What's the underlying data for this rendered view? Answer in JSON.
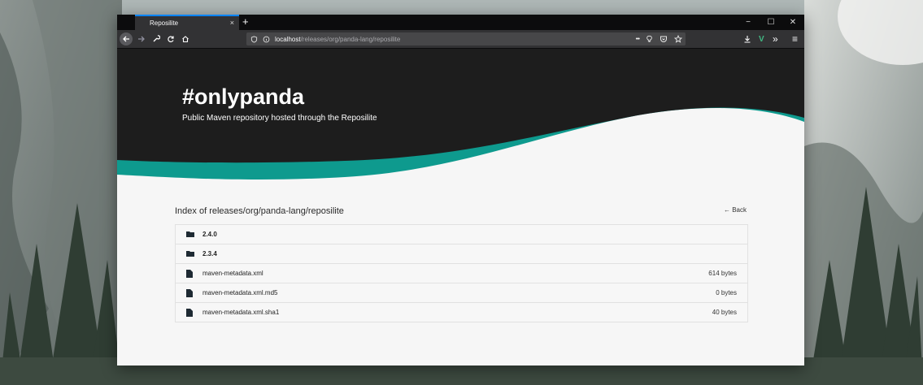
{
  "browser": {
    "tab_title": "Reposilite",
    "tab_close": "×",
    "new_tab": "+",
    "window_controls": {
      "minimize": "−",
      "maximize": "☐",
      "close": "✕"
    },
    "url_host": "localhost",
    "url_path": "/releases/org/panda-lang/reposilite",
    "url_icons": [
      "more-icon",
      "lightbulb-icon",
      "pocket-icon",
      "star-icon"
    ],
    "toolbar_icons": [
      "download-icon",
      "vue-devtools-icon",
      "overflow-icon",
      "menu-icon"
    ],
    "more_glyph": "•••",
    "overflow_glyph": "»",
    "menu_glyph": "≡",
    "vue_glyph": "V",
    "colors": {
      "accent": "#0a84ff",
      "vue": "#41b883"
    }
  },
  "hero": {
    "title": "#onlypanda",
    "subtitle": "Public Maven repository hosted through the Reposilite",
    "colors": {
      "dark": "#1d1d1d",
      "teal": "#0e9a8e"
    }
  },
  "index": {
    "title": "Index of releases/org/panda-lang/reposilite",
    "back_label": "← Back",
    "entries": [
      {
        "type": "folder",
        "name": "2.4.0",
        "size": ""
      },
      {
        "type": "folder",
        "name": "2.3.4",
        "size": ""
      },
      {
        "type": "file",
        "name": "maven-metadata.xml",
        "size": "614 bytes"
      },
      {
        "type": "file",
        "name": "maven-metadata.xml.md5",
        "size": "0 bytes"
      },
      {
        "type": "file",
        "name": "maven-metadata.xml.sha1",
        "size": "40 bytes"
      }
    ]
  }
}
